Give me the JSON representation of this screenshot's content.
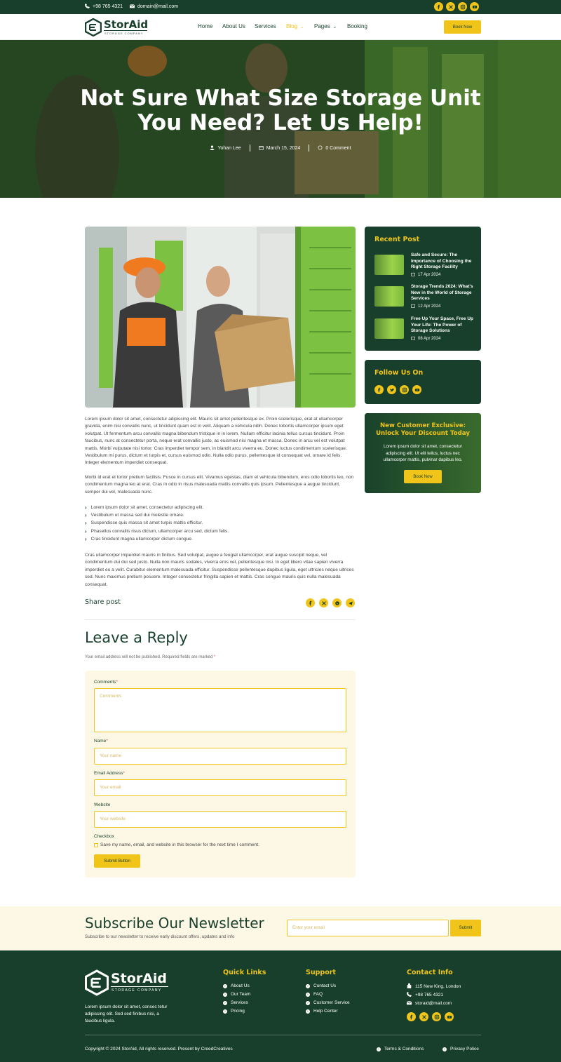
{
  "colors": {
    "brand_dark": "#173f2b",
    "accent": "#f0c419",
    "cream": "#fdf8e6"
  },
  "topbar": {
    "phone": "+98 765 4321",
    "email": "domain@mail.com"
  },
  "brand": {
    "name": "StorAid",
    "tagline": "STORAGE COMPANY"
  },
  "nav": {
    "items": [
      "Home",
      "About Us",
      "Services",
      "Blog",
      "Pages",
      "Booking"
    ],
    "active": "Blog",
    "cta": "Book Now"
  },
  "hero": {
    "title": "Not Sure What Size Storage Unit You Need? Let Us Help!",
    "author": "Yohan Lee",
    "date": "March 15, 2024",
    "comments": "0 Comment"
  },
  "article": {
    "p1": "Lorem ipsum dolor sit amet, consectetur adipiscing elit. Mauris sit amet pellentesque ex. Proin scelerisque, erat at ullamcorper gravida, enim nisi convallis nunc, ut tincidunt quam est in velit. Aliquam a vehicula nibh. Donec lobortis ullamcorper ipsum eget volutpat. Ut fermentum arcu convallis magna bibendum tristique in in lorem. Nullam efficitur lacinia tellus cursus tincidunt. Proin faucibus, nunc at consectetur porta, neque erat convallis justo, ac euismod nisi magna et massa. Donec in arcu vel est volutpat mattis. Morbi vulputate nisi tortor. Cras imperdiet tempor sem, in blandit arcu viverra eu. Donec luctus condimentum scelerisque. Vestibulum mi purus, dictum et turpis et, cursus euismod odio. Nulla odio purus, pellentesque id consequat vel, ornare id felis. Integer elementum imperdiet consequat.",
    "p2": "Morbi id erat et tortor pretium facilisis. Fusce in cursus elit. Vivamus egestas, diam et vehicula bibendum, eros odio lobortis leo, non condimentum magna leo at erat. Cras in odio in risus malesuada mattis convallis quis ipsum. Pellentesque a augue tincidunt, semper dui vel, malesuada nunc.",
    "list": [
      "Lorem ipsum dolor sit amet, consectetur adipiscing elit.",
      "Vestibulum ut massa sed dui molestie ornare.",
      "Suspendisse quis massa sit amet turpis mattis efficitur.",
      "Phasellus convallis risus dictum, ullamcorper arcu sed, dictum felis.",
      "Cras tincidunt magna ullamcorper dictum congue."
    ],
    "p3": "Cras ullamcorper imperdiet mauris in finibus. Sed volutpat, augue a feugiat ullamcorper, erat augue suscipit neque, vel condimentum dui dui sed justo. Nulla non mauris sodales, viverra eros vel, pellentesque nisi. In eget libero vitae sapien viverra imperdiet eu a velit. Curabitur elementum malesuada efficitur. Suspendisse pellentesque dapibus ligula, eget ultricies neque ultrices sed. Nunc maximus pretium posuere. Integer consectetur fringilla sapien et mattis. Cras congue mauris quis nulla malesuada consequat.",
    "share_label": "Share post"
  },
  "reply": {
    "heading": "Leave a Reply",
    "note": "Your email address will not be published. Required fields are marked",
    "note_star": "*",
    "comments_label": "Comments",
    "comments_placeholder": "Comments",
    "name_label": "Name",
    "name_placeholder": "Your name",
    "email_label": "Email Address",
    "email_placeholder": "Your email",
    "website_label": "Website",
    "website_placeholder": "Your website",
    "checkbox_label": "Checkbox",
    "checkbox_text": "Save my name, email, and website in this browser for the next time I comment.",
    "submit": "Submit Button",
    "star": "*"
  },
  "sidebar": {
    "recent_heading": "Recent Post",
    "posts": [
      {
        "title": "Safe and Secure: The Importance of Choosing the Right Storage Facility",
        "date": "17 Apr 2024"
      },
      {
        "title": "Storage Trends 2024: What's New in the World of Storage Services",
        "date": "12 Apr 2024"
      },
      {
        "title": "Free Up Your Space, Free Up Your Life: The Power of Storage Solutions",
        "date": "08 Apr 2024"
      }
    ],
    "follow_heading": "Follow Us On",
    "promo_title": "New Customer Exclusive: Unlock Your Discount Today",
    "promo_text": "Lorem ipsum dolor sit amet, consectetur adipiscing elit. Ut elit tellus, luctus nec ullamcorper mattis, pulvinar dapibus leo.",
    "promo_button": "Book Now"
  },
  "newsletter": {
    "heading": "Subscribe Our Newsletter",
    "sub": "Subscribe to our newsletter to receive early discount offers, updates and info",
    "placeholder": "Enter your email",
    "button": "Submit"
  },
  "footer": {
    "about": "Lorem ipsum dolor sit amet, consec tetur adipiscing elit. Sed sed finibus nisi, a faucibus ligula.",
    "quick_heading": "Quick Links",
    "quick": [
      "About Us",
      "Our Team",
      "Services",
      "Pricing"
    ],
    "support_heading": "Support",
    "support": [
      "Contact Us",
      "FAQ",
      "Customer Service",
      "Help Center"
    ],
    "contact_heading": "Contact Info",
    "address": "115 New King, London",
    "phone": "+98 765 4321",
    "email": "storaid@mail.com",
    "copyright": "Copyright © 2024 StorAid, All rights reserved. Present by CreedCreatives",
    "terms": "Terms & Conditions",
    "privacy": "Privacy Police"
  }
}
